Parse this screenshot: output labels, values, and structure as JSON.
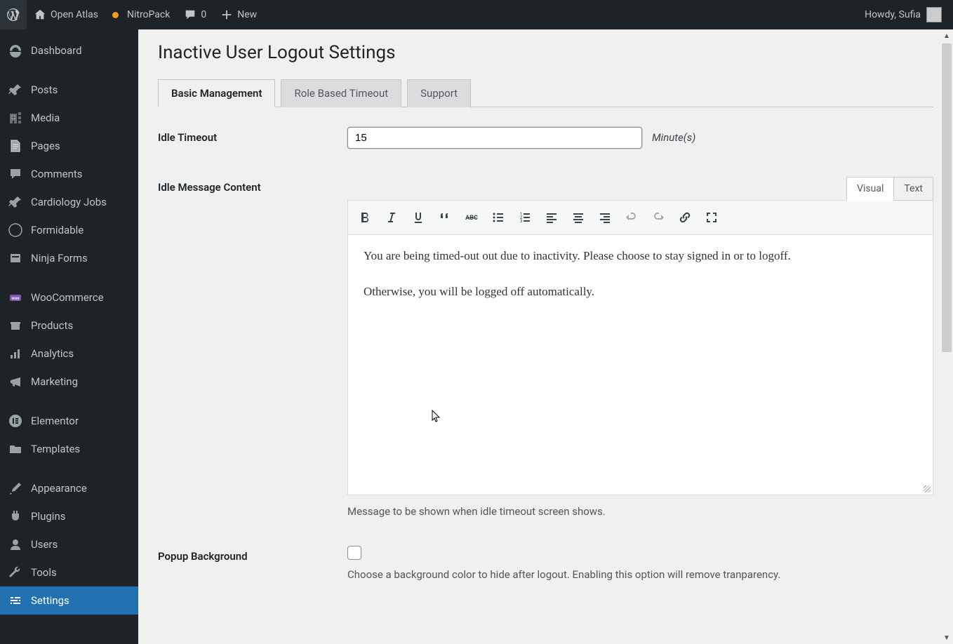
{
  "toolbar": {
    "site_name": "Open Atlas",
    "nitro_label": "NitroPack",
    "comments_count": "0",
    "new_label": "New",
    "greeting": "Howdy, Sufia"
  },
  "sidebar": {
    "items": [
      {
        "label": "Dashboard",
        "icon": "dashboard"
      },
      {
        "label": "Posts",
        "icon": "pin"
      },
      {
        "label": "Media",
        "icon": "media"
      },
      {
        "label": "Pages",
        "icon": "pages"
      },
      {
        "label": "Comments",
        "icon": "comment"
      },
      {
        "label": "Cardiology Jobs",
        "icon": "pin"
      },
      {
        "label": "Formidable",
        "icon": "form"
      },
      {
        "label": "Ninja Forms",
        "icon": "ninja"
      },
      {
        "label": "WooCommerce",
        "icon": "woo"
      },
      {
        "label": "Products",
        "icon": "box"
      },
      {
        "label": "Analytics",
        "icon": "bar"
      },
      {
        "label": "Marketing",
        "icon": "mega"
      },
      {
        "label": "Elementor",
        "icon": "elementor"
      },
      {
        "label": "Templates",
        "icon": "folder"
      },
      {
        "label": "Appearance",
        "icon": "brush"
      },
      {
        "label": "Plugins",
        "icon": "plug"
      },
      {
        "label": "Users",
        "icon": "user"
      },
      {
        "label": "Tools",
        "icon": "wrench"
      },
      {
        "label": "Settings",
        "icon": "sliders",
        "current": true
      }
    ]
  },
  "page": {
    "title": "Inactive User Logout Settings",
    "tabs": [
      {
        "label": "Basic Management",
        "active": true
      },
      {
        "label": "Role Based Timeout"
      },
      {
        "label": "Support"
      }
    ],
    "idle_timeout": {
      "label": "Idle Timeout",
      "value": "15",
      "suffix": "Minute(s)"
    },
    "idle_message": {
      "label": "Idle Message Content",
      "editor_tabs": {
        "visual": "Visual",
        "text": "Text"
      },
      "paragraphs": [
        "You are being timed-out out due to inactivity. Please choose to stay signed in or to logoff.",
        "Otherwise, you will be logged off automatically."
      ],
      "help": "Message to be shown when idle timeout screen shows."
    },
    "popup_bg": {
      "label": "Popup Background",
      "help": "Choose a background color to hide after logout. Enabling this option will remove tranparency."
    }
  }
}
